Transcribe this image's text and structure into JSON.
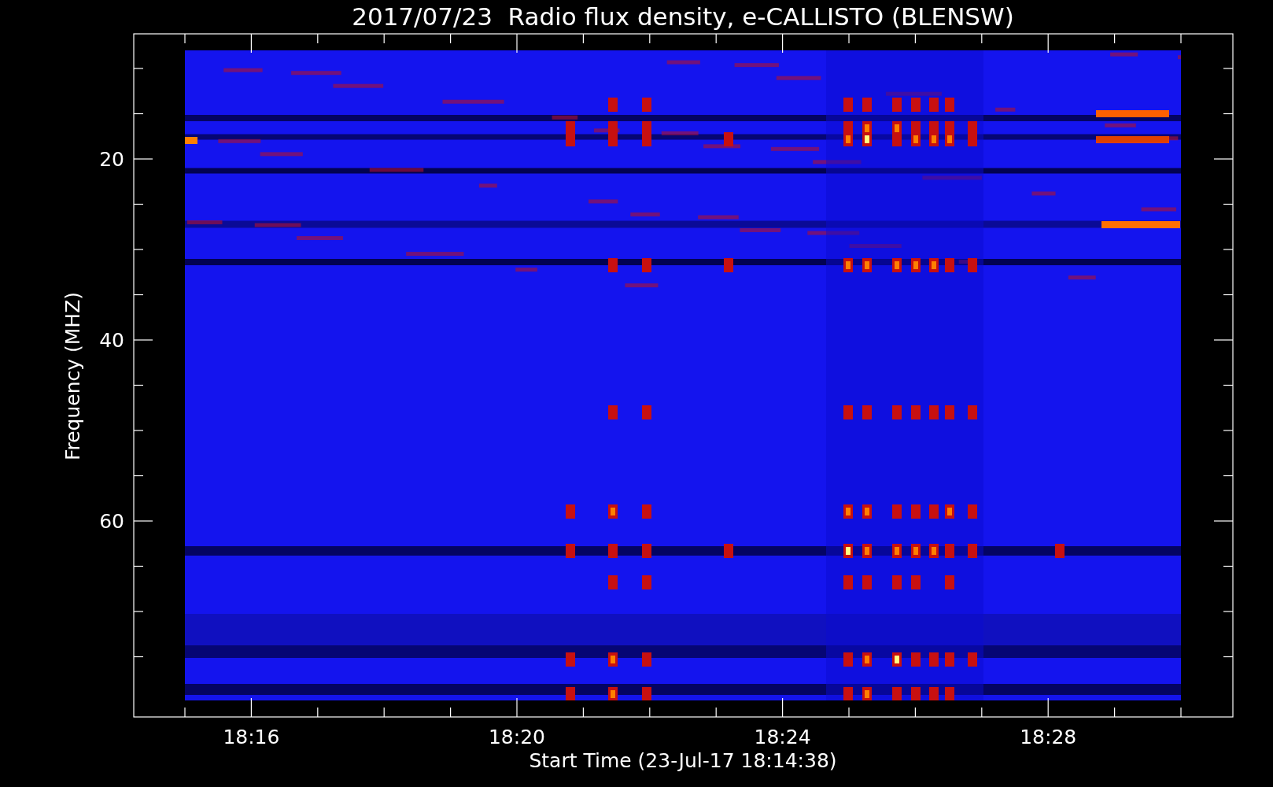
{
  "title": "2017/07/23  Radio flux density, e-CALLISTO (BLENSW)",
  "y_axis": {
    "title": "Frequency (MHZ)",
    "tick_labels": [
      "20",
      "40",
      "60"
    ]
  },
  "x_axis": {
    "title": "Start Time (23-Jul-17 18:14:38)",
    "tick_labels": [
      "18:16",
      "18:20",
      "18:24",
      "18:28"
    ]
  }
}
